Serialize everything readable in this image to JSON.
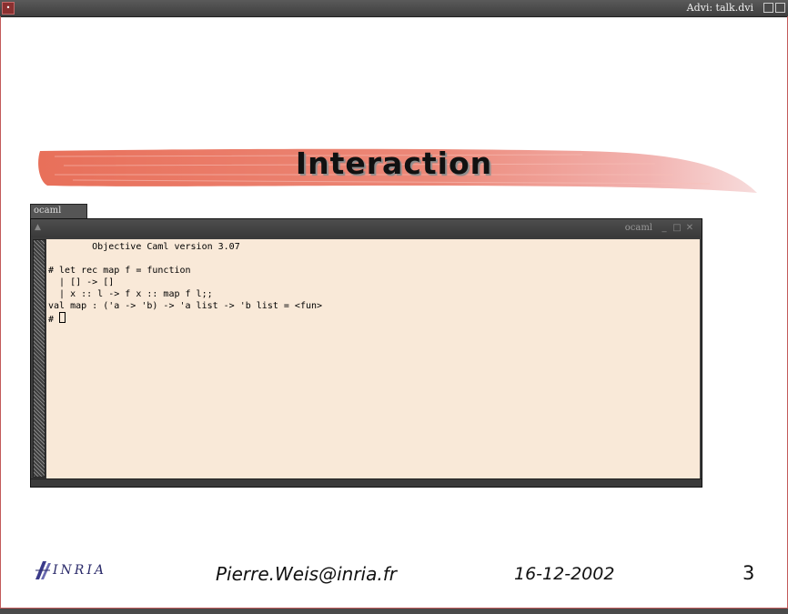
{
  "window": {
    "title": "Advi: talk.dvi"
  },
  "slide": {
    "title": "Interaction"
  },
  "terminal": {
    "tab_label": "ocaml",
    "title": "ocaml",
    "lines": [
      "        Objective Caml version 3.07",
      "",
      "# let rec map f = function",
      "  | [] -> []",
      "  | x :: l -> f x :: map f l;;",
      "val map : ('a -> 'b) -> 'a list -> 'b list = <fun>",
      "# "
    ]
  },
  "footer": {
    "logo_text": "INRIA",
    "email": "Pierre.Weis@inria.fr",
    "date": "16-12-2002",
    "page_number": "3"
  },
  "colors": {
    "brush": "#e8705a",
    "terminal_bg": "#f9e9d8",
    "frame_border": "#c25a5a"
  },
  "icons": [
    "window-menu-icon",
    "minimize-icon",
    "maximize-icon",
    "close-icon",
    "inria-logo-icon"
  ]
}
